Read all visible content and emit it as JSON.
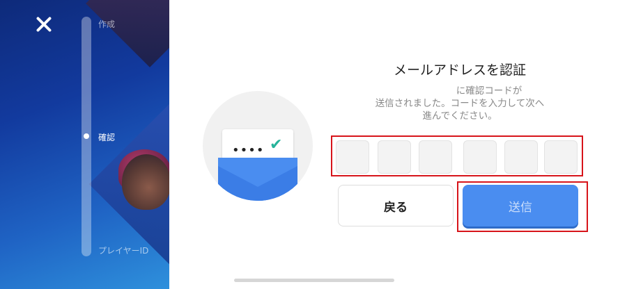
{
  "sidebar": {
    "steps": [
      {
        "label": "作成",
        "active": false
      },
      {
        "label": "確認",
        "active": true
      },
      {
        "label": "プレイヤーID",
        "active": false
      }
    ]
  },
  "main": {
    "title": "メールアドレスを認証",
    "description_lines": [
      "に確認コードが",
      "送信されました。コードを入力して次へ",
      "進んでください。"
    ],
    "code_digits": [
      "",
      "",
      "",
      "",
      "",
      ""
    ],
    "back_label": "戻る",
    "send_label": "送信"
  },
  "illustration": {
    "dots": "••••",
    "check": "✔"
  },
  "colors": {
    "primary_button": "#4a8df0",
    "highlight_frame": "#d7141a",
    "check": "#27b39b"
  }
}
